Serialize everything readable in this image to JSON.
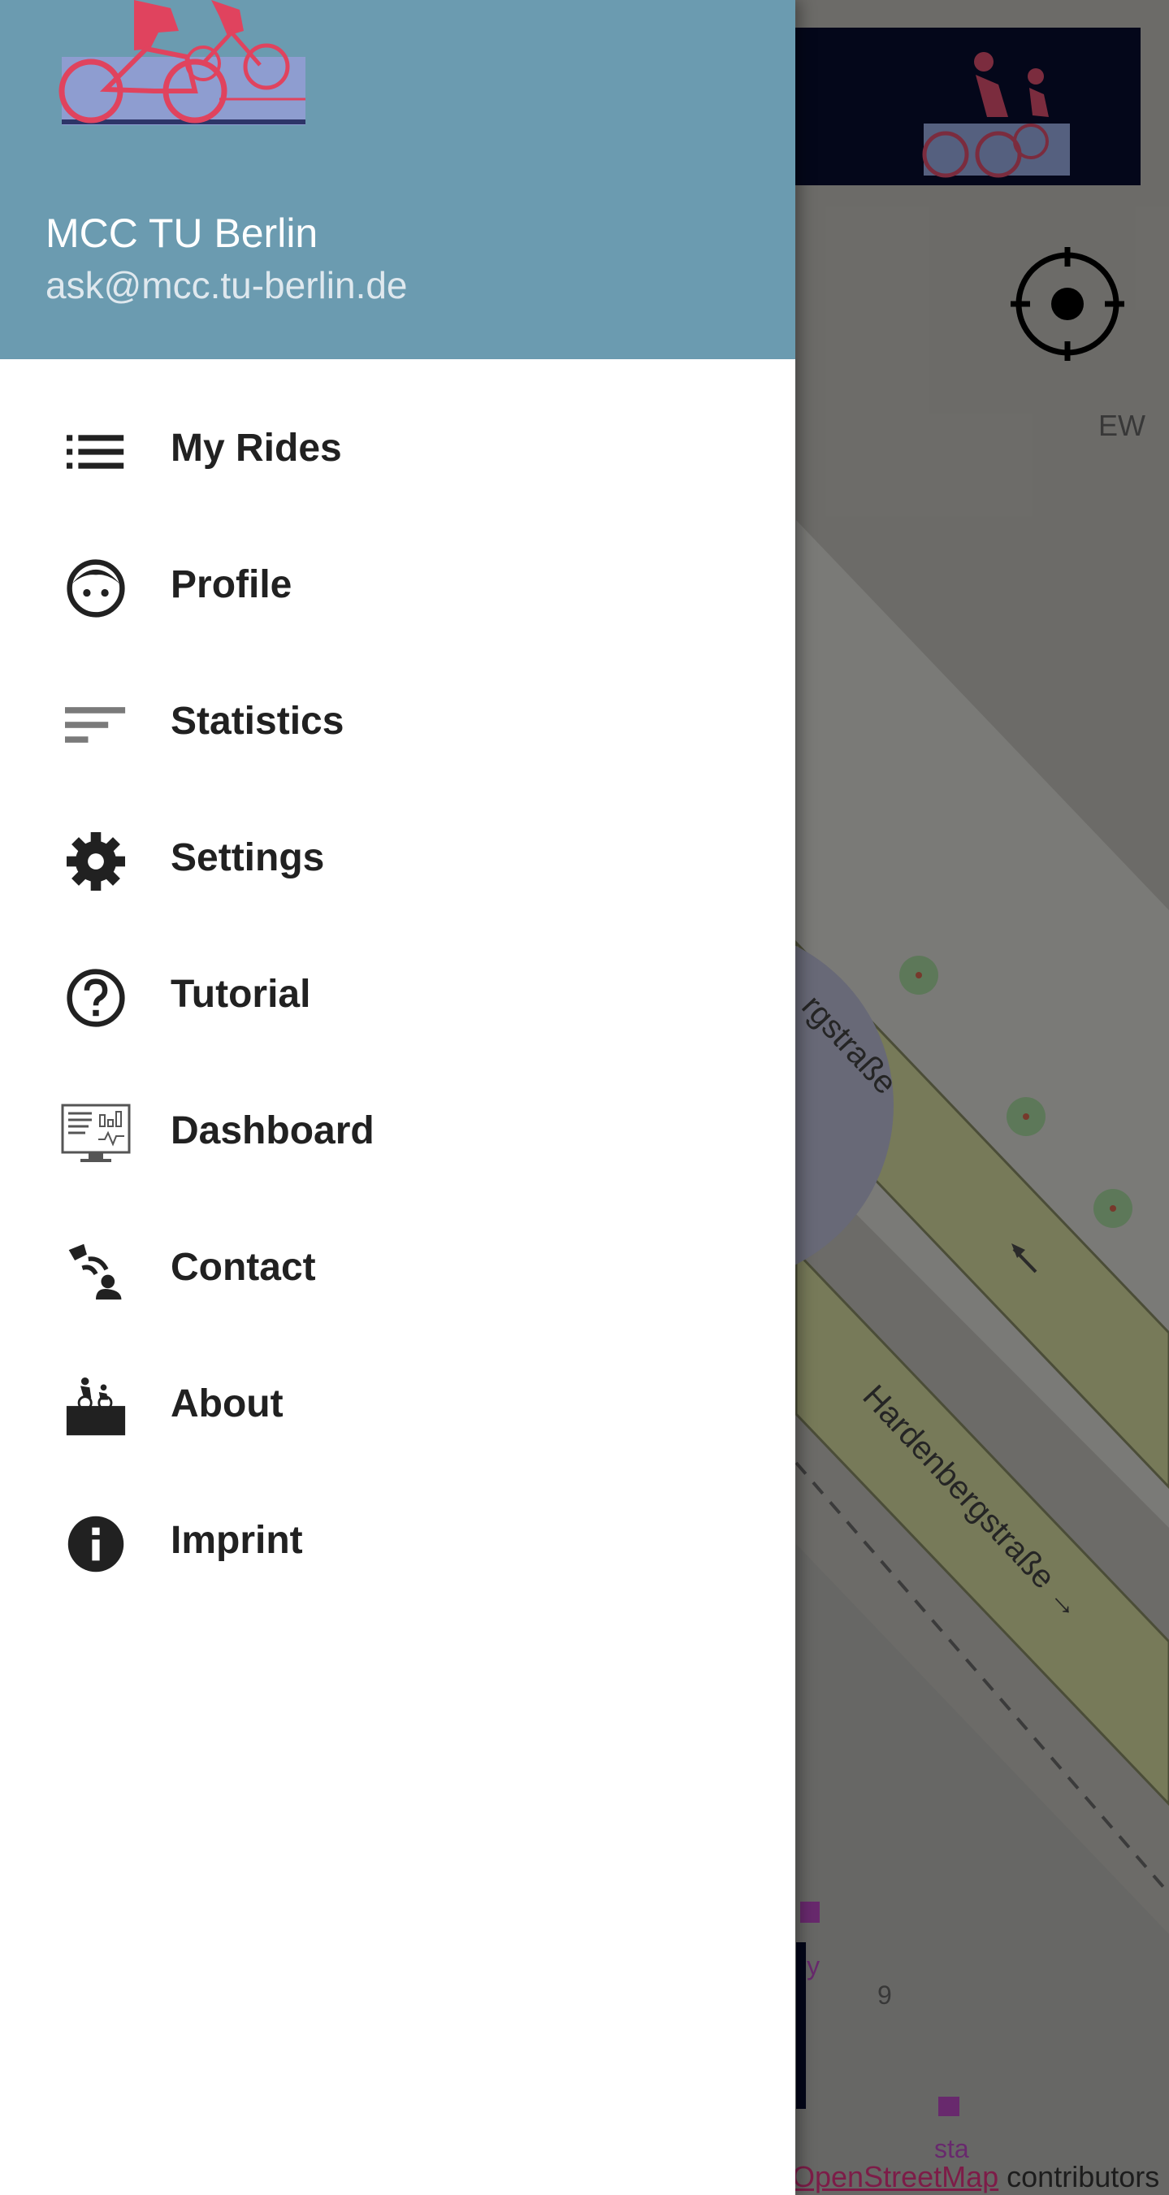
{
  "header": {
    "name": "MCC TU Berlin",
    "email": "ask@mcc.tu-berlin.de"
  },
  "menu": [
    {
      "label": "My Rides",
      "icon": "list-icon"
    },
    {
      "label": "Profile",
      "icon": "face-icon"
    },
    {
      "label": "Statistics",
      "icon": "sort-bars-icon"
    },
    {
      "label": "Settings",
      "icon": "gear-icon"
    },
    {
      "label": "Tutorial",
      "icon": "help-circle-icon"
    },
    {
      "label": "Dashboard",
      "icon": "dashboard-monitor-icon"
    },
    {
      "label": "Contact",
      "icon": "contact-icon"
    },
    {
      "label": "About",
      "icon": "tandem-bike-icon"
    },
    {
      "label": "Imprint",
      "icon": "info-icon"
    }
  ],
  "map": {
    "street_labels": [
      "rgstraße",
      "Hardenbergstraße →"
    ],
    "labels": [
      "EW",
      "9",
      "ly",
      "sta"
    ],
    "attribution_link": "OpenStreetMap",
    "attribution_suffix": " contributors"
  },
  "colors": {
    "header": "#6b9bb0",
    "logo_red": "#e0435e",
    "logo_blue": "#7c8fc9",
    "map_bg": "#6d6d6a"
  }
}
